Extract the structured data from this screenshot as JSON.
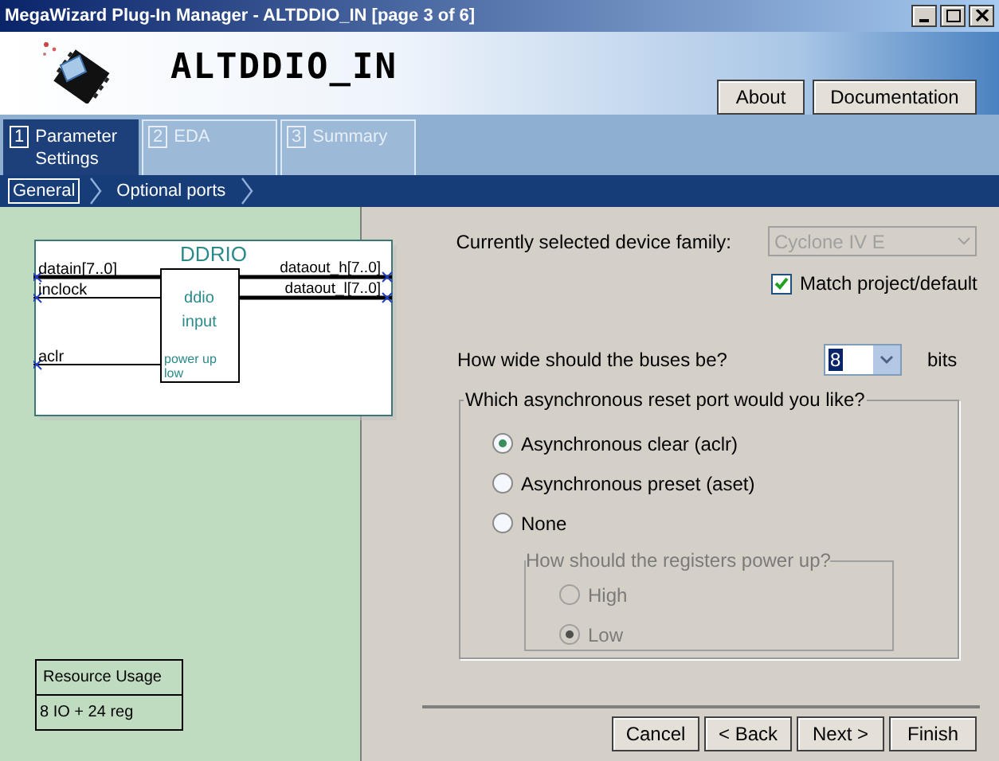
{
  "window": {
    "title": "MegaWizard Plug-In Manager - ALTDDIO_IN [page 3 of 6]"
  },
  "header": {
    "title": "ALTDDIO_IN",
    "buttons": [
      "About",
      "Documentation"
    ]
  },
  "tabs": [
    {
      "number": "1",
      "label": "Parameter Settings",
      "selected": true
    },
    {
      "number": "2",
      "label": "EDA",
      "selected": false
    },
    {
      "number": "3",
      "label": "Summary",
      "selected": false
    }
  ],
  "breadcrumb": [
    {
      "label": "General",
      "selected": true
    },
    {
      "label": "Optional ports",
      "selected": false
    }
  ],
  "diagram": {
    "title": "DDRIO",
    "inputs": [
      "datain[7..0]",
      "inclock",
      "aclr"
    ],
    "outputs": [
      "dataout_h[7..0]",
      "dataout_l[7..0]"
    ],
    "block_lines": [
      "ddio",
      "input"
    ],
    "block_note": [
      "power up",
      "low"
    ]
  },
  "resource_usage": {
    "heading": "Resource Usage",
    "value": "8 IO + 24 reg"
  },
  "device_family": {
    "label": "Currently selected device family:",
    "value": "Cyclone IV E",
    "disabled": true
  },
  "match_default": {
    "label": "Match project/default",
    "checked": true
  },
  "bus_width": {
    "label": "How wide should the buses be?",
    "value": "8",
    "unit": "bits"
  },
  "reset_group": {
    "title": "Which asynchronous reset port would you like?",
    "options": [
      {
        "label": "Asynchronous clear (aclr)",
        "selected": true
      },
      {
        "label": "Asynchronous preset (aset)",
        "selected": false
      },
      {
        "label": "None",
        "selected": false
      }
    ]
  },
  "power_up_group": {
    "title": "How should the registers power up?",
    "disabled": true,
    "options": [
      {
        "label": "High",
        "selected": false
      },
      {
        "label": "Low",
        "selected": true
      }
    ]
  },
  "footer_buttons": [
    "Cancel",
    "< Back",
    "Next >",
    "Finish"
  ]
}
